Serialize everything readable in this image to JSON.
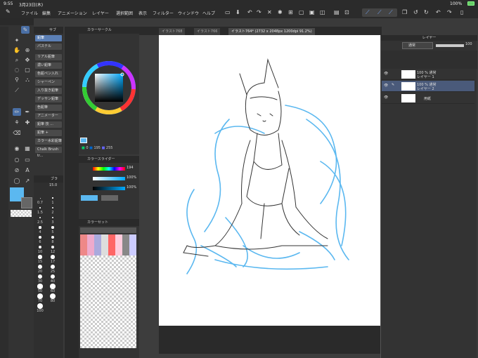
{
  "status": {
    "time": "9:55",
    "date": "3月23日(木)",
    "battery": "100%"
  },
  "menu": [
    "ファイル",
    "編集",
    "アニメーション",
    "レイヤー",
    "選択範囲",
    "表示",
    "フィルター",
    "ウィンドウ",
    "ヘルプ"
  ],
  "tabs": [
    {
      "label": "イラスト768"
    },
    {
      "label": "イラスト766"
    },
    {
      "label": "イラスト764* (2732 x 2048px 1200dpi 91.2%)"
    }
  ],
  "subtool": {
    "header": "サブ",
    "items": [
      "鉛筆",
      "パステル",
      "リアル鉛筆",
      "濃い鉛筆",
      "色鉛ペン入れ",
      "シャーペン",
      "入り抜き鉛筆",
      "デッサン鉛筆",
      "色鉛筆",
      "アニメーター",
      "鉛筆 技 ...",
      "鉛筆 +",
      "カラー水彩鉛筆",
      "Chalk Brush tr..."
    ]
  },
  "brush_size": {
    "header": "ブラ",
    "value": "15.0",
    "sizes": [
      "0.7",
      "1",
      "1.5",
      "2",
      "2.5",
      "3",
      "4",
      "5",
      "6",
      "8",
      "10",
      "12",
      "15",
      "17",
      "20",
      "25",
      "30",
      "40",
      "50",
      "60",
      "70",
      "80",
      "100"
    ]
  },
  "color_circle": {
    "header": "カラーサークル",
    "h": "0",
    "s": "195",
    "v": "255"
  },
  "color_slider": {
    "header": "カラースライダー",
    "h": "194",
    "s": "100%",
    "v": "100%"
  },
  "color_set": {
    "header": "カラーセット"
  },
  "layer_panel": {
    "header": "レイヤー",
    "blend_mode": "通常",
    "opacity": "100",
    "layers": [
      {
        "opacity": "100 % 通常",
        "name": "レイヤー 1"
      },
      {
        "opacity": "100 % 通常",
        "name": "レイヤー 2"
      },
      {
        "opacity": "",
        "name": "用紙"
      }
    ]
  },
  "colors": {
    "accent": "#4a6fa5",
    "main_color": "#5bb8f0",
    "sketch_blue": "#5bb8f0",
    "canvas_bg": "#ffffff"
  }
}
